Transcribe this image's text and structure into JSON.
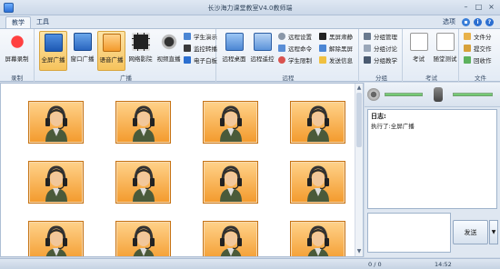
{
  "window": {
    "title": "长沙海力课堂教室V4.0教师端",
    "minimize": "–",
    "maximize": "□",
    "close": "×"
  },
  "tabs": [
    {
      "label": "教学",
      "active": true
    },
    {
      "label": "工具",
      "active": false
    }
  ],
  "options_label": "选项",
  "ribbon": {
    "record": {
      "label": "录制",
      "buttons": [
        "屏幕录制"
      ]
    },
    "broadcast": {
      "label": "广播",
      "big": [
        "全屏广播",
        "窗口广播",
        "语音广播",
        "网络影院",
        "视频直播"
      ],
      "small": [
        "学生演示",
        "监控转播",
        "电子白板"
      ]
    },
    "remote": {
      "label": "远程",
      "big": [
        "远程桌面",
        "远程遥控"
      ],
      "small": [
        "远程设置",
        "远程命令",
        "学生限制",
        "黑屏肃静",
        "解除黑屏",
        "发送信息"
      ]
    },
    "group": {
      "label": "分组",
      "small": [
        "分组管理",
        "分组讨论",
        "分组教学"
      ]
    },
    "exam": {
      "label": "考试",
      "big": [
        "考试",
        "随堂测试"
      ]
    },
    "file": {
      "label": "文件",
      "small": [
        "文件分",
        "提交作",
        "回收作"
      ]
    }
  },
  "log": {
    "header": "日志:",
    "lines": [
      "执行了:全屏广播"
    ]
  },
  "send_label": "发送",
  "status": {
    "count": "0 / 0",
    "time": "14:52"
  },
  "colors": {
    "selected": "#f6c35c",
    "tile": "#f39a2c",
    "accent": "#2c6fd0"
  },
  "students": {
    "count": 12,
    "icon": "student-headset-icon"
  }
}
